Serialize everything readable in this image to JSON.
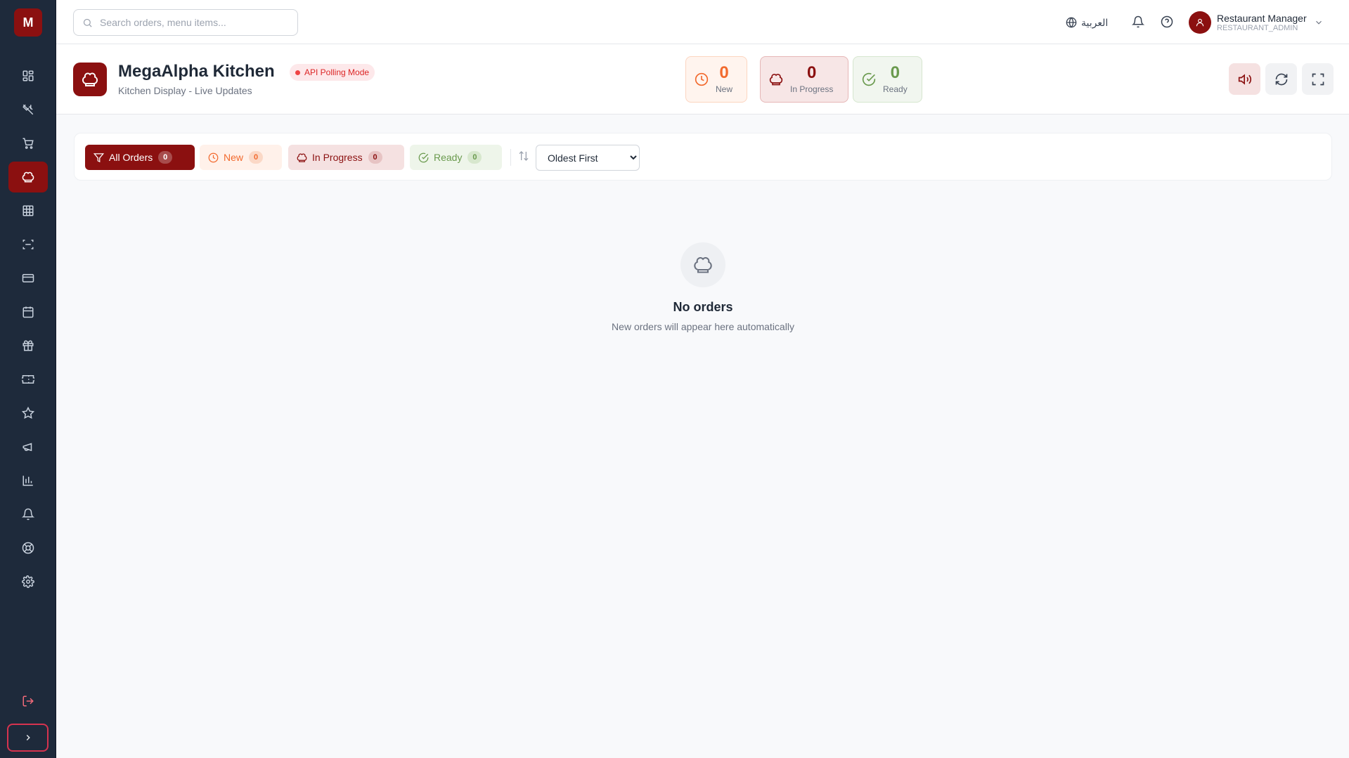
{
  "app": {
    "logo_letter": "M",
    "brand_color": "#8b1010"
  },
  "sidebar": {
    "items": [
      {
        "icon": "dashboard-icon",
        "active": false
      },
      {
        "icon": "utensils-icon",
        "active": false
      },
      {
        "icon": "cart-icon",
        "active": false
      },
      {
        "icon": "chef-hat-icon",
        "active": true
      },
      {
        "icon": "table-grid-icon",
        "active": false
      },
      {
        "icon": "scan-icon",
        "active": false
      },
      {
        "icon": "credit-card-icon",
        "active": false
      },
      {
        "icon": "calendar-icon",
        "active": false
      },
      {
        "icon": "gift-icon",
        "active": false
      },
      {
        "icon": "ticket-icon",
        "active": false
      },
      {
        "icon": "star-icon",
        "active": false
      },
      {
        "icon": "megaphone-icon",
        "active": false
      },
      {
        "icon": "bar-chart-icon",
        "active": false
      },
      {
        "icon": "bell-icon",
        "active": false
      },
      {
        "icon": "lifebuoy-icon",
        "active": false
      },
      {
        "icon": "gear-icon",
        "active": false
      }
    ],
    "logout_icon": "logout-icon",
    "expand_icon": "chevron-right-icon"
  },
  "topbar": {
    "search_placeholder": "Search orders, menu items...",
    "language_label": "العربية",
    "user_name": "Restaurant Manager",
    "user_role": "RESTAURANT_ADMIN"
  },
  "header": {
    "title": "MegaAlpha Kitchen",
    "mode_badge": "API Polling Mode",
    "subtitle": "Kitchen Display - Live Updates",
    "stats": {
      "new": {
        "count": "0",
        "label": "New"
      },
      "in_progress": {
        "count": "0",
        "label": "In Progress"
      },
      "ready": {
        "count": "0",
        "label": "Ready"
      }
    }
  },
  "filters": {
    "all": {
      "label": "All Orders",
      "count": "0"
    },
    "new": {
      "label": "New",
      "count": "0"
    },
    "in_progress": {
      "label": "In Progress",
      "count": "0"
    },
    "ready": {
      "label": "Ready",
      "count": "0"
    },
    "sort_selected": "Oldest First"
  },
  "empty_state": {
    "title": "No orders",
    "subtitle": "New orders will appear here automatically"
  },
  "colors": {
    "sidebar_bg": "#1e2a3b",
    "accent": "#8b1010",
    "new": "#f26a2e",
    "ready": "#6a9a4e",
    "alert": "#dc2626"
  }
}
